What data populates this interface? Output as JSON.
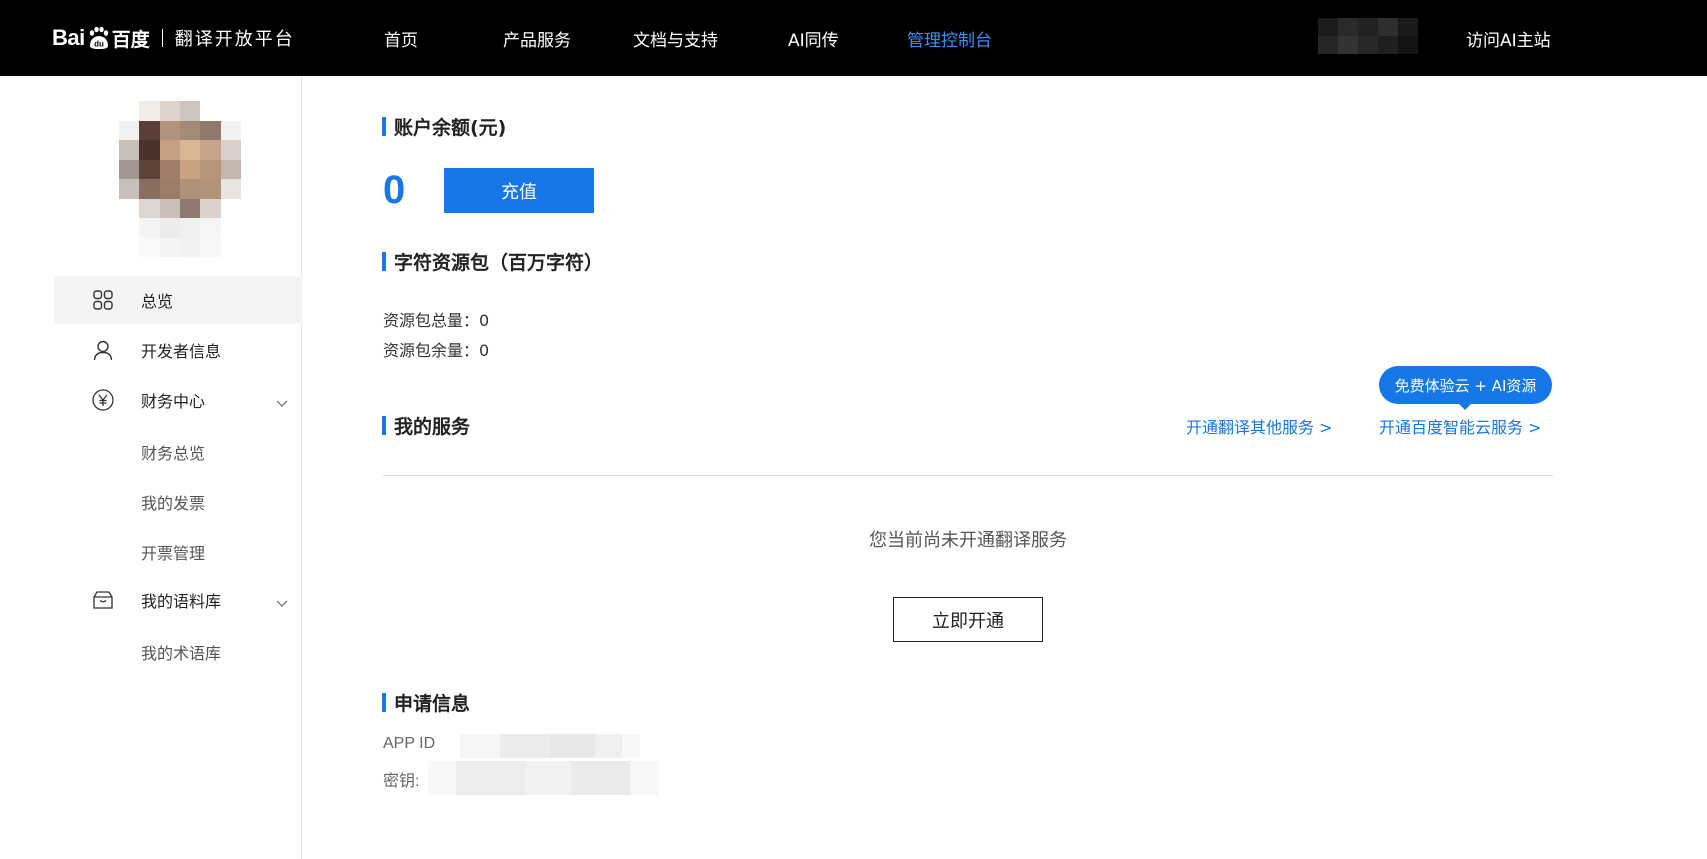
{
  "header": {
    "logo_bai": "Bai",
    "logo_du": "du",
    "logo_cn": "百度",
    "logo_sub": "翻译开放平台",
    "nav": [
      "首页",
      "产品服务",
      "文档与支持",
      "AI同传",
      "管理控制台"
    ],
    "active_nav": "管理控制台",
    "visit_label": "访问AI主站"
  },
  "sidebar": {
    "items": [
      {
        "label": "总览",
        "icon": "grid-icon",
        "active": true
      },
      {
        "label": "开发者信息",
        "icon": "user-icon"
      },
      {
        "label": "财务中心",
        "icon": "yuan-circle-icon",
        "expandable": true
      },
      {
        "label": "财务总览"
      },
      {
        "label": "我的发票"
      },
      {
        "label": "开票管理"
      },
      {
        "label": "我的语料库",
        "icon": "box-icon",
        "expandable": true
      },
      {
        "label": "我的术语库"
      }
    ]
  },
  "account": {
    "title": "账户余额(元)",
    "balance": "0",
    "recharge_label": "充值"
  },
  "package": {
    "title": "字符资源包（百万字符）",
    "total": "资源包总量：0",
    "remaining": "资源包余量：0"
  },
  "services": {
    "title": "我的服务",
    "link_other": "开通翻译其他服务 >",
    "link_cloud": "开通百度智能云服务 >",
    "promo": "免费体验云 + AI资源",
    "empty_text": "您当前尚未开通翻译服务",
    "open_label": "立即开通"
  },
  "application": {
    "title": "申请信息",
    "app_id_label": "APP ID",
    "key_label": "密钥:"
  },
  "colors": {
    "accent": "#1677e8",
    "topbar": "#000000",
    "active_nav": "#3a8ef7"
  }
}
